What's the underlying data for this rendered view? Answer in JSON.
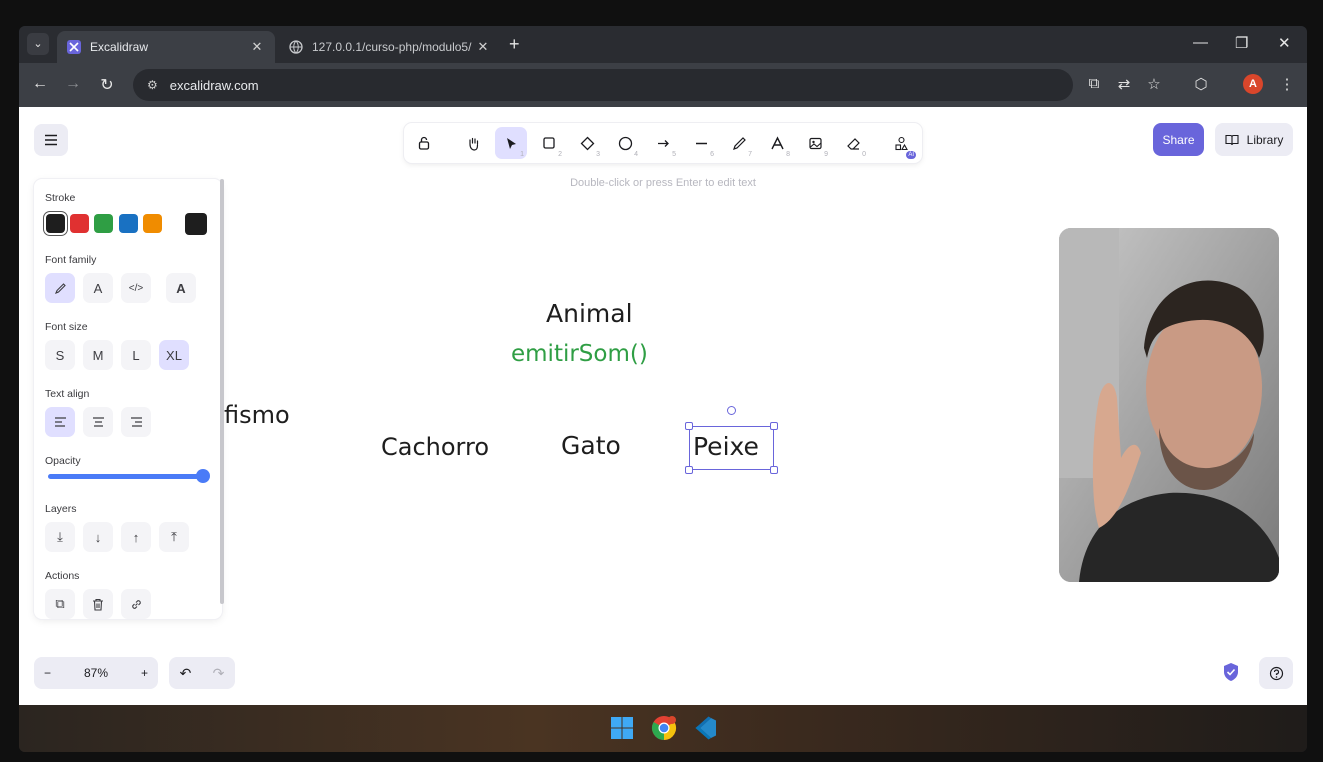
{
  "browser": {
    "tabs": [
      {
        "title": "Excalidraw",
        "active": true,
        "favicon": "excalidraw-icon"
      },
      {
        "title": "127.0.0.1/curso-php/modulo5/",
        "active": false,
        "favicon": "globe-icon"
      }
    ],
    "url": "excalidraw.com",
    "profile_initial": "A"
  },
  "toolbar": {
    "tools": [
      {
        "name": "lock",
        "icon": "lock-icon",
        "key": ""
      },
      {
        "name": "hand",
        "icon": "hand-icon",
        "key": ""
      },
      {
        "name": "selection",
        "icon": "pointer-icon",
        "key": "1",
        "selected": true
      },
      {
        "name": "rectangle",
        "icon": "rectangle-icon",
        "key": "2"
      },
      {
        "name": "diamond",
        "icon": "diamond-icon",
        "key": "3"
      },
      {
        "name": "ellipse",
        "icon": "ellipse-icon",
        "key": "4"
      },
      {
        "name": "arrow",
        "icon": "arrow-icon",
        "key": "5"
      },
      {
        "name": "line",
        "icon": "line-icon",
        "key": "6"
      },
      {
        "name": "draw",
        "icon": "pencil-icon",
        "key": "7"
      },
      {
        "name": "text",
        "icon": "text-icon",
        "key": "8"
      },
      {
        "name": "image",
        "icon": "image-icon",
        "key": "9"
      },
      {
        "name": "eraser",
        "icon": "eraser-icon",
        "key": "0"
      },
      {
        "name": "more-tools",
        "icon": "shapes-icon",
        "key": "",
        "badge": "AI"
      }
    ],
    "hint": "Double-click or press Enter to edit text"
  },
  "top_right": {
    "share_label": "Share",
    "library_label": "Library"
  },
  "properties": {
    "stroke_label": "Stroke",
    "stroke_colors": [
      "#1e1e1e",
      "#e03131",
      "#2f9e44",
      "#1971c2",
      "#f08c00"
    ],
    "current_stroke": "#1e1e1e",
    "font_family_label": "Font family",
    "font_size_label": "Font size",
    "font_sizes": [
      "S",
      "M",
      "L",
      "XL"
    ],
    "selected_font_size": "XL",
    "text_align_label": "Text align",
    "opacity_label": "Opacity",
    "opacity_value": 100,
    "layers_label": "Layers",
    "actions_label": "Actions"
  },
  "canvas": {
    "texts": [
      {
        "id": "animal",
        "text": "Animal",
        "color": "#1e1e1e"
      },
      {
        "id": "emitir",
        "text": "emitirSom()",
        "color": "#2f9e44"
      },
      {
        "id": "fismo",
        "text": "fismo",
        "color": "#1e1e1e"
      },
      {
        "id": "cachorro",
        "text": "Cachorro",
        "color": "#1e1e1e"
      },
      {
        "id": "gato",
        "text": "Gato",
        "color": "#1e1e1e"
      },
      {
        "id": "peixe",
        "text": "Peixe",
        "color": "#1e1e1e",
        "selected": true
      }
    ]
  },
  "bottom": {
    "zoom": "87%"
  },
  "taskbar": {
    "apps": [
      "windows-start-icon",
      "chrome-icon",
      "vscode-icon"
    ]
  },
  "colors": {
    "accent": "#6965db",
    "selected_bg": "#e0dfff",
    "panel_bg": "#ececf4"
  }
}
